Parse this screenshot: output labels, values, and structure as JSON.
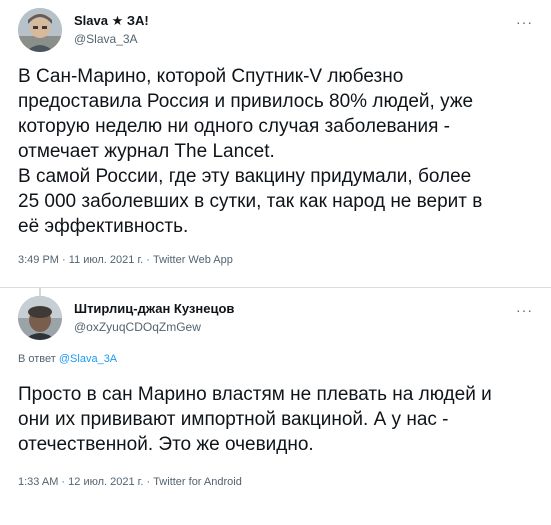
{
  "tweets": [
    {
      "author_name": "Slava ★ ЗА!",
      "author_handle": "@Slava_3A",
      "more_label": "···",
      "lines": [
        "В Сан-Марино, которой Спутник-V любезно",
        "предоставила Россия и привилось 80% людей, уже",
        "которую неделю ни одного случая заболевания -",
        "отмечает журнал The Lancet.",
        "В самой России, где эту вакцину придумали, более",
        "25 000 заболевших в сутки, так как народ не верит в",
        "её эффективность."
      ],
      "time": "3:49 PM",
      "date": "11 июл. 2021 г.",
      "separator": "·",
      "app": "Twitter Web App"
    },
    {
      "author_name": "Штирлиц-джан Кузнецов",
      "author_handle": "@oxZyuqCDOqZmGew",
      "more_label": "···",
      "reply_prefix": "В ответ",
      "reply_to": "@Slava_3A",
      "lines": [
        "Просто в сан Марино властям не плевать на людей и",
        "они их прививают импортной вакциной. А у нас -",
        "отечественной. Это же очевидно."
      ],
      "time": "1:33 AM",
      "date": "12 июл. 2021 г.",
      "separator": "·",
      "app": "Twitter for Android"
    }
  ],
  "colors": {
    "text": "#0f1419",
    "muted": "#536471",
    "link": "#1d9bf0",
    "divider": "#d9dde0"
  }
}
